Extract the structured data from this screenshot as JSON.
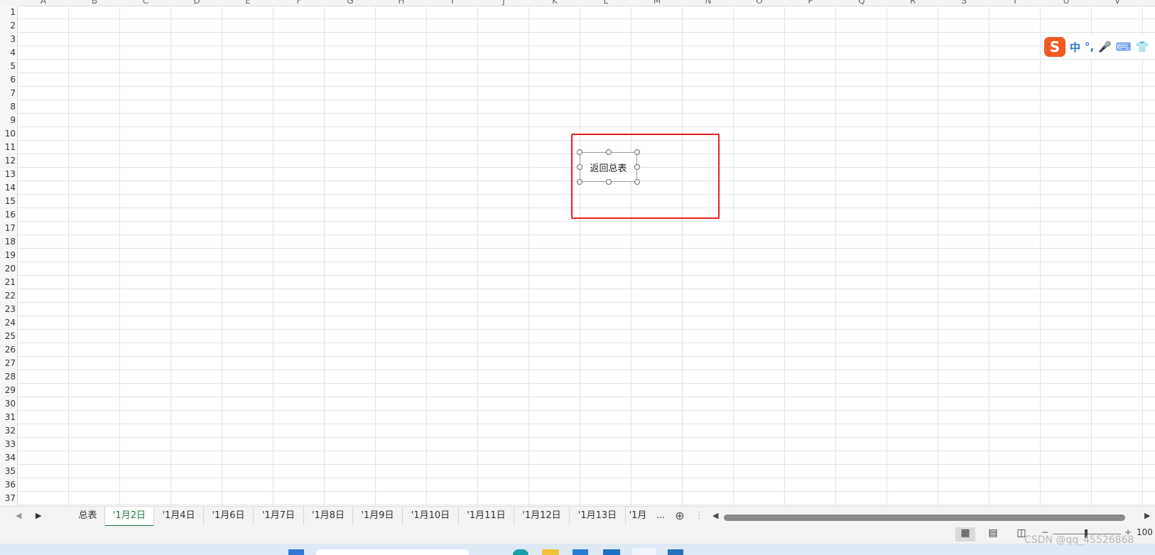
{
  "columns": [
    "A",
    "B",
    "C",
    "D",
    "E",
    "F",
    "G",
    "H",
    "I",
    "J",
    "K",
    "L",
    "M",
    "N",
    "O",
    "P",
    "Q",
    "R",
    "S",
    "T",
    "U",
    "V"
  ],
  "rows": [
    "1",
    "2",
    "3",
    "4",
    "5",
    "6",
    "7",
    "8",
    "9",
    "10",
    "11",
    "12",
    "13",
    "14",
    "15",
    "16",
    "17",
    "18",
    "19",
    "20",
    "21",
    "22",
    "23",
    "24",
    "25",
    "26",
    "27",
    "28",
    "29",
    "30",
    "31",
    "32",
    "33",
    "34",
    "35",
    "36",
    "37"
  ],
  "shape": {
    "label": "返回总表"
  },
  "ime": {
    "logo": "S",
    "items": [
      "中",
      "°,",
      "🎤",
      "⌨",
      "👕"
    ]
  },
  "sheet_tabs": [
    "总表",
    "'1月2日",
    "'1月4日",
    "'1月6日",
    "'1月7日",
    "'1月8日",
    "'1月9日",
    "'1月10日",
    "'1月11日",
    "'1月12日",
    "'1月13日",
    "'1月"
  ],
  "active_tab_index": 1,
  "more_tabs_label": "...",
  "add_sheet_label": "⊕",
  "zoom": {
    "minus": "−",
    "plus": "+",
    "value": "100"
  },
  "watermark": "CSDN @qq_45526868",
  "colors": {
    "highlight": "#e62020",
    "active_tab": "#1e7a3c",
    "ime_logo": "#f05a22"
  }
}
